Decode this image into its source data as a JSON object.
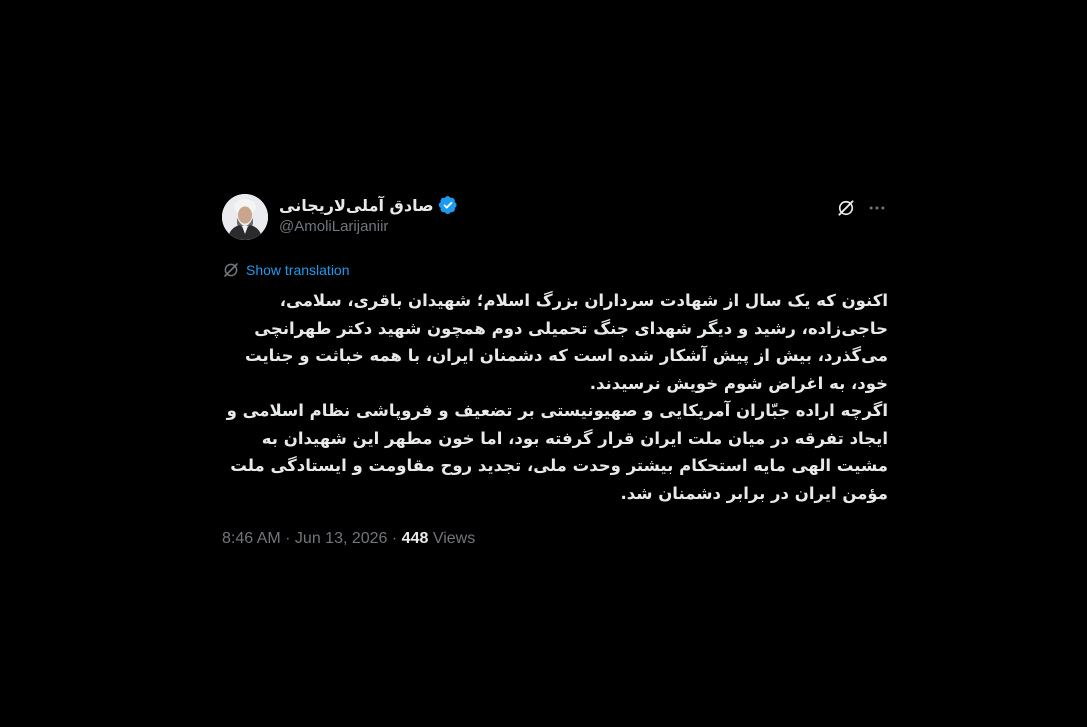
{
  "author": {
    "display_name": "صادق آملی‌لاریجانی",
    "handle": "@AmoliLarijaniir",
    "verified": true
  },
  "translate_label": "Show translation",
  "body": "اکنون که یک سال از شهادت سرداران بزرگ اسلام؛ شهیدان باقری، سلامی، حاجی‌زاده، رشید و دیگر شهدای جنگ تحمیلی دوم همچون شهید دکتر طهرانچی می‌گذرد، بیش از پیش آشکار شده است که دشمنان ایران، با همه خباثت و جنایت خود، به اغراض شوم خویش نرسیدند.\nاگرچه اراده جبّاران آمریکایی و صهیونیستی بر تضعیف و فروپاشی نظام اسلامی و ایجاد تفرقه در میان ملت ایران قرار گرفته بود، اما خون مطهر این شهیدان به مشیت الهی مایه استحکام بیشتر وحدت ملی، تجدید روح مقاومت و ایستادگی ملت مؤمن ایران در برابر دشمنان شد.",
  "meta": {
    "time": "8:46 AM",
    "sep1": " · ",
    "date": "Jun 13, 2026",
    "sep2": " · ",
    "views_count": "448",
    "views_label": " Views"
  },
  "icons": {
    "grok": "grok-icon",
    "more": "more-icon",
    "translate": "translate-icon",
    "verified": "verified-badge-icon"
  },
  "colors": {
    "background": "#000000",
    "text": "#e7e9ea",
    "secondary": "#71767b",
    "accent": "#1d9bf0"
  }
}
